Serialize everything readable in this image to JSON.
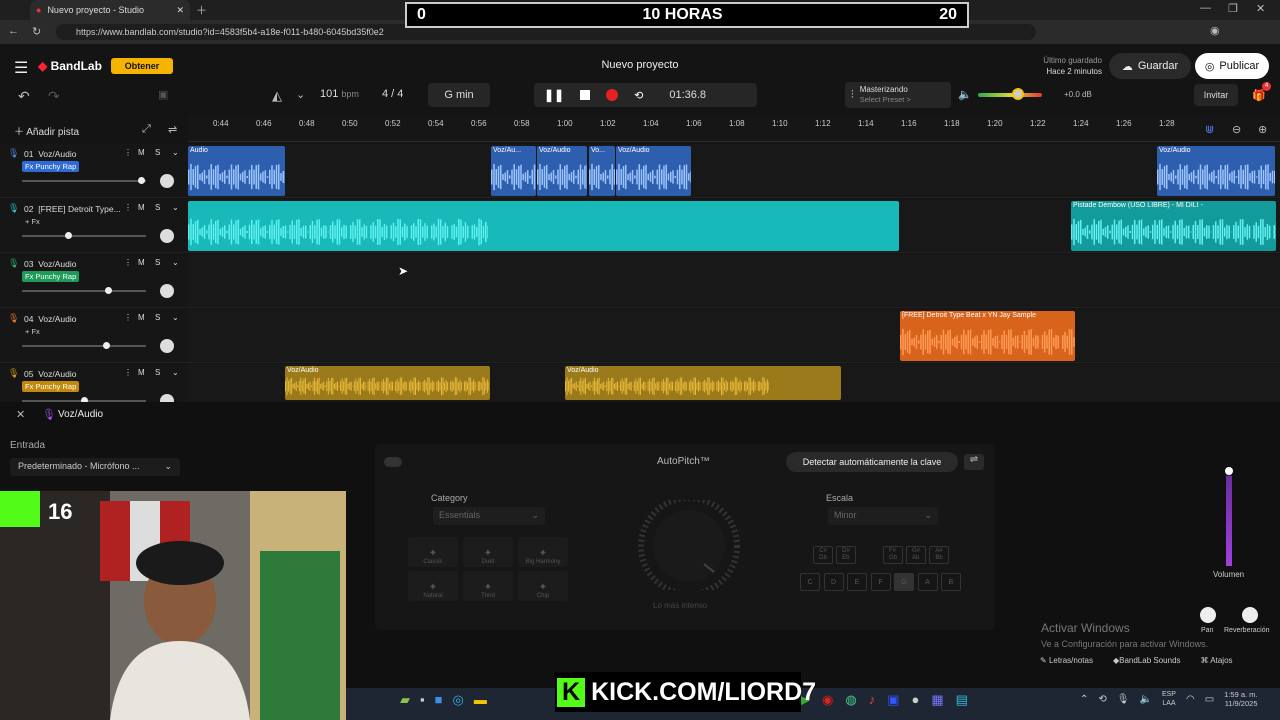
{
  "browser": {
    "tab_title": "Nuevo proyecto - Studio",
    "url": "https://www.bandlab.com/studio?id=4583f5b4-a18e-f011-b480-6045bd35f0e2"
  },
  "timer_overlay": {
    "left": "0",
    "center": "10 HORAS",
    "right": "20"
  },
  "app": {
    "brand": "BandLab",
    "obtener_label": "Obtener",
    "project_title": "Nuevo proyecto",
    "last_saved_label": "Último guardado",
    "last_saved_time": "Hace 2 minutos",
    "save_label": "Guardar",
    "publish_label": "Publicar",
    "invite_label": "Invitar",
    "gift_badge": "4"
  },
  "transport": {
    "tempo": "101",
    "tempo_unit": "bpm",
    "time_sig": "4 / 4",
    "key": "G min",
    "time": "01:36.8",
    "mastering_label": "Masterizando",
    "preset_label": "Select Preset >",
    "master_db": "+0.0 dB",
    "master_level": 0.62
  },
  "toolbar": {
    "add_track_label": "Añadir pista"
  },
  "ruler": [
    "0:44",
    "0:46",
    "0:48",
    "0:50",
    "0:52",
    "0:54",
    "0:56",
    "0:58",
    "1:00",
    "1:02",
    "1:04",
    "1:06",
    "1:08",
    "1:10",
    "1:12",
    "1:14",
    "1:16",
    "1:18",
    "1:20",
    "1:22",
    "1:24",
    "1:26",
    "1:28"
  ],
  "tracks": [
    {
      "num": "01",
      "name": "Voz/Audio",
      "fx": "Fx Punchy Rap",
      "color": "#4a8fe0",
      "fx_color": "#2e6bd6",
      "vol": 0.96
    },
    {
      "num": "02",
      "name": "[FREE] Detroit Type...",
      "fx": "+ Fx",
      "color": "#22c9c9",
      "fx_color": "",
      "vol": 0.37
    },
    {
      "num": "03",
      "name": "Voz/Audio",
      "fx": "Fx Punchy Rap",
      "color": "#2fb36a",
      "fx_color": "#1e9a5a",
      "vol": 0.69
    },
    {
      "num": "04",
      "name": "Voz/Audio",
      "fx": "+ Fx",
      "color": "#f07a24",
      "fx_color": "",
      "vol": 0.68
    },
    {
      "num": "05",
      "name": "Voz/Audio",
      "fx": "Fx Punchy Rap",
      "color": "#d9a21c",
      "fx_color": "#c2890f",
      "vol": 0.5
    }
  ],
  "clips": {
    "t1": [
      "Audio",
      "Voz/Au...",
      "Voz/Audio",
      "Vo...",
      "Voz/Audio",
      "Voz/Audio"
    ],
    "t2": [
      "",
      "Pistade Dembow (USO LIBRE) - MI DILI -"
    ],
    "t4": [
      "[FREE] Detroit Type Beat x YN Jay Sample"
    ],
    "t5": [
      "Voz/Audio",
      "Voz/Audio"
    ]
  },
  "panel": {
    "track_name": "Voz/Audio",
    "input_label": "Entrada",
    "input_value": "Predeterminado - Micrófono ...",
    "autopitch_title": "AutoPitch™",
    "detect_key_label": "Detectar automáticamente la clave",
    "category_label": "Category",
    "category_value": "Essentials",
    "scale_label": "Escala",
    "scale_value": "Minor",
    "presets": [
      "Classic",
      "Duet",
      "Big Harmony",
      "Natural",
      "Third",
      "Chip"
    ],
    "dial_label": "Lo más intenso",
    "keys_top": [
      "C#\nDb",
      "D#\nEb",
      "F#\nGb",
      "G#\nAb",
      "A#\nBb"
    ],
    "keys_bottom": [
      "C",
      "D",
      "E",
      "F",
      "G",
      "A",
      "B"
    ],
    "volume_label": "Volumen",
    "pan_label": "Pan",
    "reverb_label": "Reverberación",
    "lyrics_label": "Letras/notas",
    "sounds_label": "BandLab Sounds",
    "shortcuts_label": "Atajos"
  },
  "windows": {
    "activate_title": "Activar Windows",
    "activate_sub": "Ve a Configuración para activar Windows.",
    "lang1": "ESP",
    "lang2": "LAA",
    "clock_time": "1:59 a. m.",
    "clock_date": "11/9/2025"
  },
  "stream": {
    "kick_url": "KICK.COM/LIORD7",
    "kick_count": "16"
  }
}
